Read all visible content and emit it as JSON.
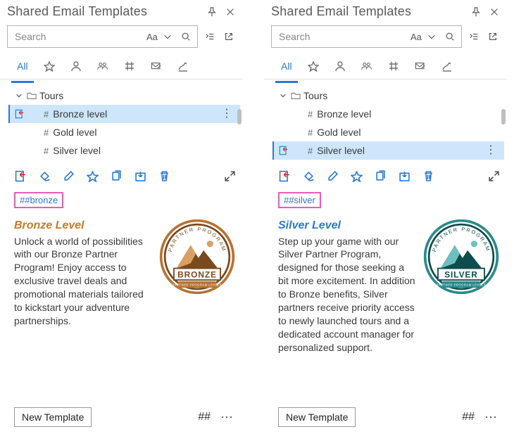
{
  "panels": [
    {
      "title": "Shared Email Templates",
      "search": {
        "placeholder": "Search",
        "aa": "Aa"
      },
      "tabs": {
        "all": "All"
      },
      "folder": "Tours",
      "items": {
        "bronze": "Bronze level",
        "gold": "Gold level",
        "silver": "Silver level"
      },
      "selected": "bronze",
      "tag": "##bronze",
      "preview": {
        "title": "Bronze Level",
        "titleColor": "#c67b28",
        "text": "Unlock a world of possibilities with our Bronze Partner Program! Enjoy access to exclusive travel deals and promotional materials tailored to kickstart your adventure partnerships.",
        "badgeLabel": "BRONZE",
        "badgeMain": "#b87333",
        "badgeDark": "#7a4a1f",
        "badgeAccent": "#d9a066"
      },
      "footer": {
        "newTemplate": "New Template",
        "hash": "##"
      }
    },
    {
      "title": "Shared Email Templates",
      "search": {
        "placeholder": "Search",
        "aa": "Aa"
      },
      "tabs": {
        "all": "All"
      },
      "folder": "Tours",
      "items": {
        "bronze": "Bronze level",
        "gold": "Gold level",
        "silver": "Silver level"
      },
      "selected": "silver",
      "tag": "##silver",
      "preview": {
        "title": "Silver Level",
        "titleColor": "#2b78d8",
        "text": "Step up your game with our Silver Partner Program, designed for those seeking a bit more excitement. In addition to Bronze benefits, Silver partners receive priority access to newly launched tours and a dedicated account manager for personalized support.",
        "badgeLabel": "SILVER",
        "badgeMain": "#2a8a8a",
        "badgeDark": "#0e4d4d",
        "badgeAccent": "#6fbfbf"
      },
      "footer": {
        "newTemplate": "New Template",
        "hash": "##"
      }
    }
  ]
}
